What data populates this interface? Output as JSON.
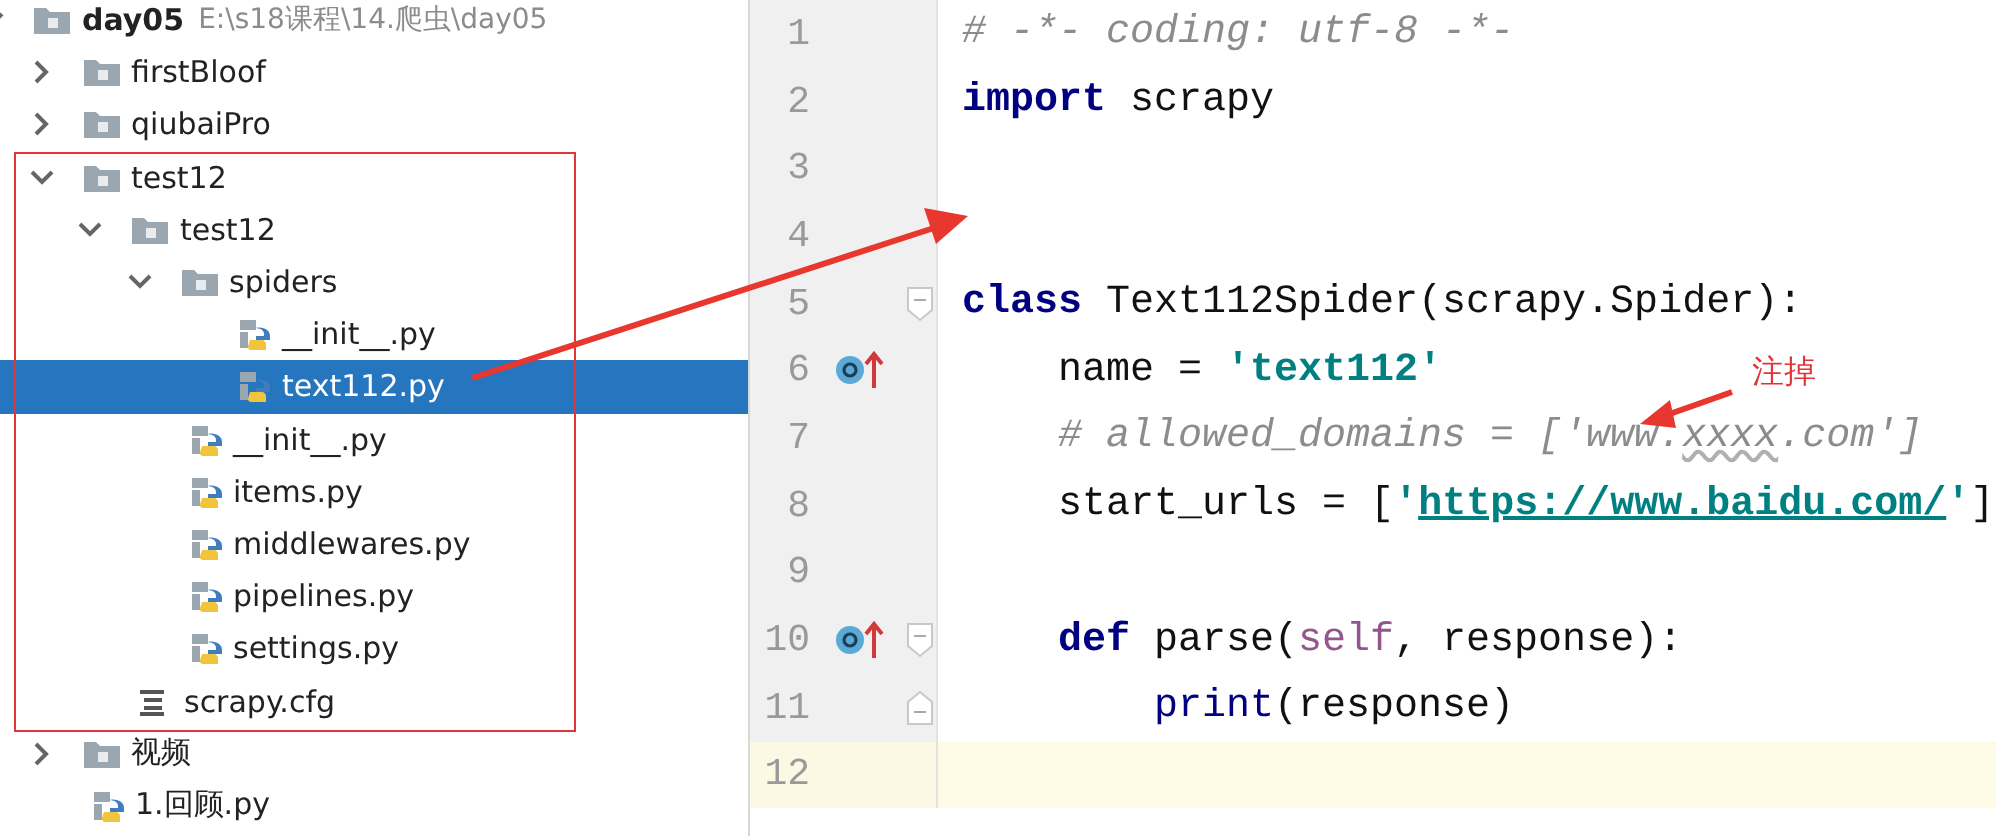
{
  "project_tree": [
    {
      "name": "day05",
      "path": "E:\\s18课程\\14.爬虫\\day05",
      "kind": "folder",
      "expanded": true,
      "selected": false,
      "children": [
        {
          "name": "firstBloof",
          "kind": "folder",
          "expanded": false,
          "selected": false
        },
        {
          "name": "qiubaiPro",
          "kind": "folder",
          "expanded": false,
          "selected": false
        },
        {
          "name": "test12",
          "kind": "folder",
          "expanded": true,
          "selected": false,
          "children": [
            {
              "name": "test12",
              "kind": "folder",
              "expanded": true,
              "selected": false,
              "children": [
                {
                  "name": "spiders",
                  "kind": "folder",
                  "expanded": true,
                  "selected": false,
                  "children": [
                    {
                      "name": "__init__.py",
                      "kind": "python",
                      "selected": false
                    },
                    {
                      "name": "text112.py",
                      "kind": "python",
                      "selected": true
                    }
                  ]
                },
                {
                  "name": "__init__.py",
                  "kind": "python",
                  "selected": false
                },
                {
                  "name": "items.py",
                  "kind": "python",
                  "selected": false
                },
                {
                  "name": "middlewares.py",
                  "kind": "python",
                  "selected": false
                },
                {
                  "name": "pipelines.py",
                  "kind": "python",
                  "selected": false
                },
                {
                  "name": "settings.py",
                  "kind": "python",
                  "selected": false
                }
              ]
            },
            {
              "name": "scrapy.cfg",
              "kind": "config",
              "selected": false
            }
          ]
        },
        {
          "name": "视频",
          "kind": "folder",
          "expanded": false,
          "selected": false
        },
        {
          "name": "1.回顾.py",
          "kind": "python",
          "selected": false
        }
      ]
    }
  ],
  "editor": {
    "lines": [
      {
        "number": "1",
        "tokens": [
          {
            "kind": "comment",
            "text": "# -*- coding: utf-8 -*-"
          }
        ]
      },
      {
        "number": "2",
        "tokens": [
          {
            "kind": "keyword",
            "text": "import"
          },
          {
            "kind": "plain",
            "text": " scrapy"
          }
        ]
      },
      {
        "number": "3"
      },
      {
        "number": "4"
      },
      {
        "number": "5",
        "fold_start": true,
        "tokens": [
          {
            "kind": "keyword",
            "text": "class"
          },
          {
            "kind": "plain",
            "text": " Text112Spider(scrapy.Spider):"
          }
        ]
      },
      {
        "number": "6",
        "override_marker": true,
        "tokens": [
          {
            "kind": "plain",
            "text": "    name = "
          },
          {
            "kind": "string",
            "text": "'text112'"
          }
        ]
      },
      {
        "number": "7",
        "tokens": [
          {
            "kind": "comment",
            "text": "    # allowed_domains = ['www."
          },
          {
            "kind": "typo",
            "text": "xxxx"
          },
          {
            "kind": "comment",
            "text": ".com']"
          }
        ]
      },
      {
        "number": "8",
        "tokens": [
          {
            "kind": "plain",
            "text": "    start_urls = ["
          },
          {
            "kind": "string",
            "text": "'"
          },
          {
            "kind": "link",
            "text": "https://www.baidu.com/"
          },
          {
            "kind": "string",
            "text": "'"
          },
          {
            "kind": "plain",
            "text": "]"
          }
        ]
      },
      {
        "number": "9"
      },
      {
        "number": "10",
        "override_marker": true,
        "fold_start": true,
        "tokens": [
          {
            "kind": "keyword",
            "text": "    def"
          },
          {
            "kind": "plain",
            "text": " parse("
          },
          {
            "kind": "self",
            "text": "self"
          },
          {
            "kind": "plain",
            "text": ", response):"
          }
        ]
      },
      {
        "number": "11",
        "fold_end": true,
        "tokens": [
          {
            "kind": "builtin",
            "text": "        print"
          },
          {
            "kind": "plain",
            "text": "(response)"
          }
        ]
      },
      {
        "number": "12",
        "current": true
      }
    ]
  },
  "annotation": {
    "label": "注掉"
  }
}
